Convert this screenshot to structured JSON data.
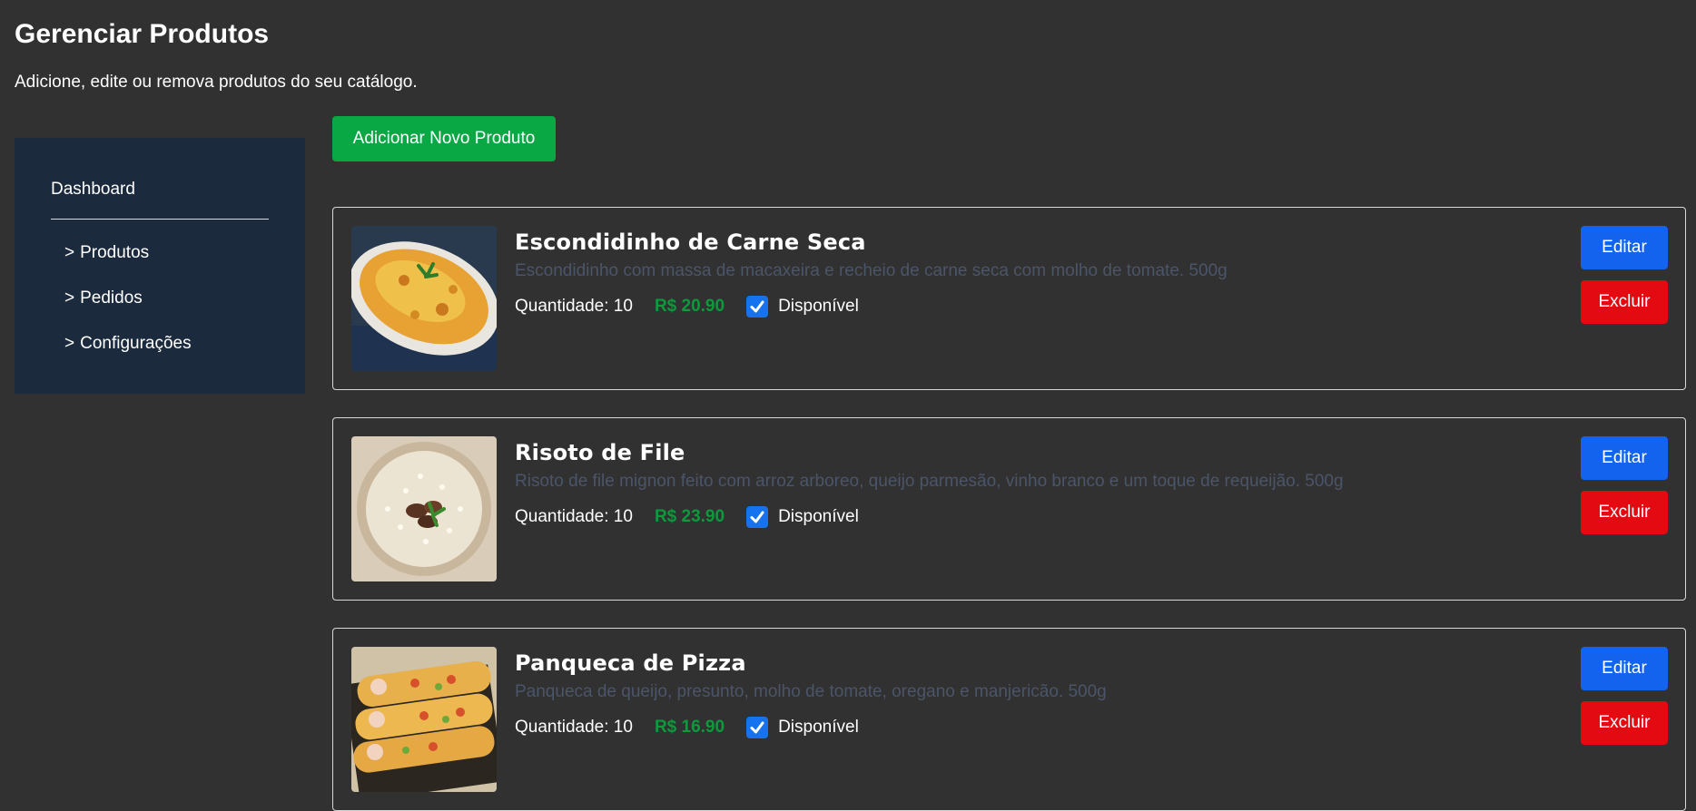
{
  "header": {
    "title": "Gerenciar Produtos",
    "subtitle": "Adicione, edite ou remova produtos do seu catálogo."
  },
  "sidebar": {
    "dashboard_label": "Dashboard",
    "items": [
      {
        "chevron": ">",
        "label": "Produtos"
      },
      {
        "chevron": ">",
        "label": "Pedidos"
      },
      {
        "chevron": ">",
        "label": "Configurações"
      }
    ]
  },
  "actions": {
    "add_label": "Adicionar Novo Produto"
  },
  "products": [
    {
      "name": "Escondidinho de Carne Seca",
      "description": "Escondidinho com massa de macaxeira e recheio de carne seca com molho de tomate. 500g",
      "quantity": "Quantidade: 10",
      "price": "R$ 20.90",
      "available_label": "Disponível",
      "available": true,
      "image": "escondidinho-photo",
      "edit_label": "Editar",
      "delete_label": "Excluir"
    },
    {
      "name": "Risoto de File",
      "description": "Risoto de file mignon feito com arroz arboreo, queijo parmesão, vinho branco e um toque de requeijão. 500g",
      "quantity": "Quantidade: 10",
      "price": "R$ 23.90",
      "available_label": "Disponível",
      "available": true,
      "image": "risoto-photo",
      "edit_label": "Editar",
      "delete_label": "Excluir"
    },
    {
      "name": "Panqueca de Pizza",
      "description": "Panqueca de queijo, presunto, molho de tomate, oregano e manjericão. 500g",
      "quantity": "Quantidade: 10",
      "price": "R$ 16.90",
      "available_label": "Disponível",
      "available": true,
      "image": "panqueca-photo",
      "edit_label": "Editar",
      "delete_label": "Excluir"
    }
  ],
  "colors": {
    "background": "#313131",
    "sidebar": "#1c2a3e",
    "add_button": "#0aa844",
    "edit_button": "#1363ee",
    "delete_button": "#e30a12",
    "price": "#0c9a3c",
    "description": "#4b5569"
  }
}
